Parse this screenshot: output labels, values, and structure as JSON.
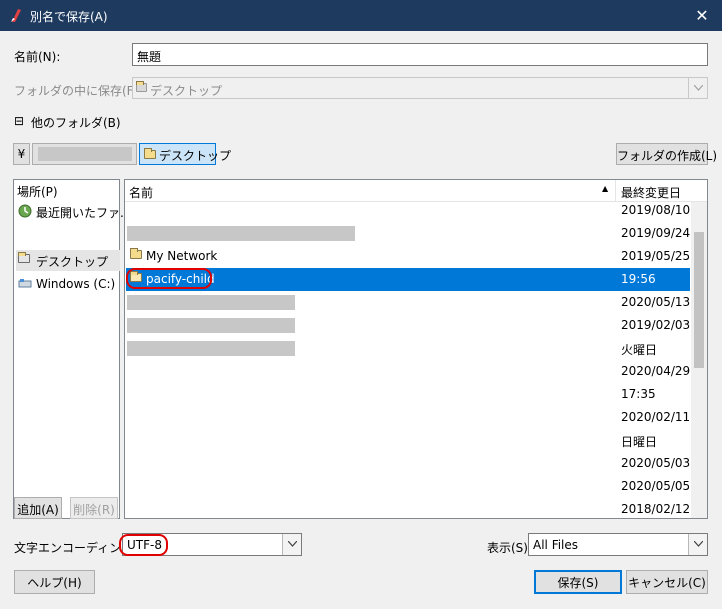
{
  "window": {
    "title": "別名で保存(A)",
    "close_glyph": "✕"
  },
  "filename": {
    "label": "名前(N):",
    "value": "無題"
  },
  "save_in": {
    "label": "フォルダの中に保存(F):",
    "value": "デスクトップ"
  },
  "other_folders": {
    "toggle": "⊟",
    "label": "他のフォルダ(B)"
  },
  "pathbar": {
    "home_glyph": "¥",
    "current": "デスクトップ",
    "create_folder": "フォルダの作成(L)"
  },
  "places": {
    "header": "場所(P)",
    "items": [
      {
        "label": "最近開いたファ...",
        "icon": "recent-icon"
      },
      {
        "label": "デスクトップ",
        "icon": "folder-icon"
      },
      {
        "label": "Windows (C:)",
        "icon": "drive-icon"
      }
    ],
    "add": "追加(A)",
    "remove": "削除(R)"
  },
  "files": {
    "col_name": "名前",
    "col_date": "最終変更日",
    "sort_glyph": "▲",
    "rows": [
      {
        "name": "",
        "date": "2019/08/10"
      },
      {
        "name": "",
        "date": "2019/09/24"
      },
      {
        "name": "My Network",
        "date": "2019/05/25"
      },
      {
        "name": "pacify-child",
        "date": "19:56"
      },
      {
        "name": "",
        "date": "2020/05/13"
      },
      {
        "name": "",
        "date": "2019/02/03"
      },
      {
        "name": "",
        "date": "火曜日"
      },
      {
        "name": "",
        "date": "2020/04/29"
      },
      {
        "name": "",
        "date": "17:35"
      },
      {
        "name": "",
        "date": "2020/02/11"
      },
      {
        "name": "",
        "date": "日曜日"
      },
      {
        "name": "",
        "date": "2020/05/03"
      },
      {
        "name": "",
        "date": "2020/05/05"
      },
      {
        "name": "",
        "date": "2018/02/12"
      }
    ]
  },
  "encoding": {
    "label": "文字エンコーディング(E)",
    "value": "UTF-8"
  },
  "filter": {
    "label": "表示(S):",
    "value": "All Files"
  },
  "buttons": {
    "help": "ヘルプ(H)",
    "save": "保存(S)",
    "cancel": "キャンセル(C)"
  },
  "colors": {
    "titlebar": "#1e3a5f",
    "selection": "#0078d7",
    "highlight_ring": "#e00000"
  }
}
